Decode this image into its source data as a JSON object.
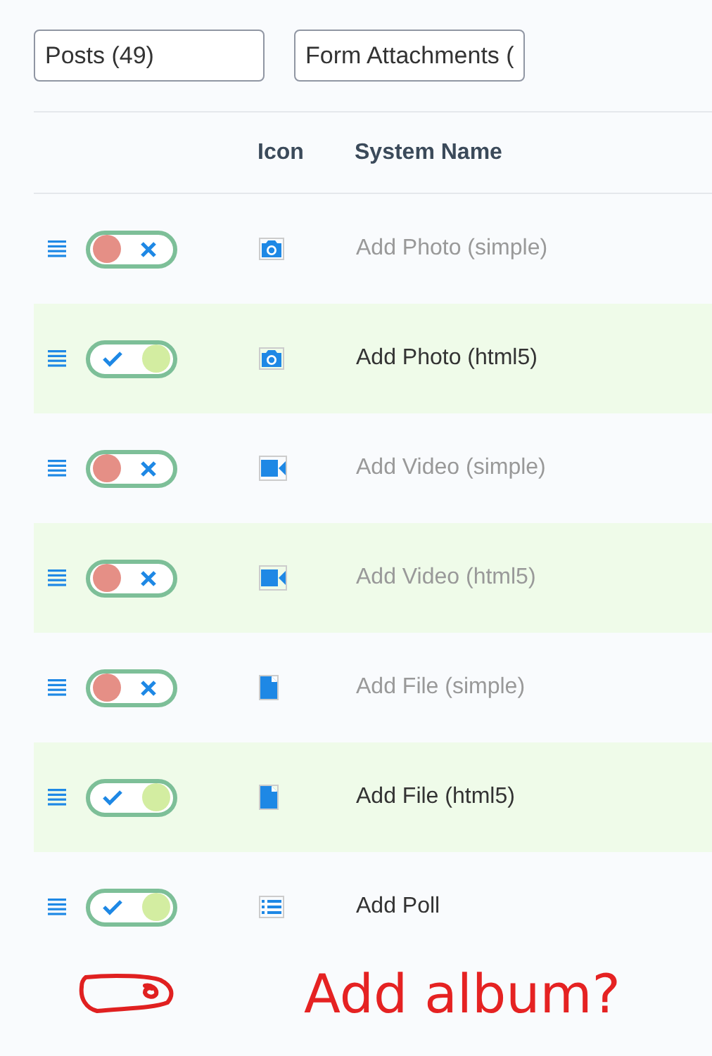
{
  "filters": [
    {
      "value": "Posts (49)"
    },
    {
      "value": "Form Attachments ("
    }
  ],
  "table": {
    "columns": [
      "Icon",
      "System Name"
    ],
    "rows": [
      {
        "on": false,
        "kind": "camera",
        "name": "Add Photo (simple)"
      },
      {
        "on": true,
        "kind": "camera",
        "name": "Add Photo (html5)"
      },
      {
        "on": false,
        "kind": "video",
        "name": "Add Video (simple)"
      },
      {
        "on": false,
        "kind": "video",
        "name": "Add Video (html5)"
      },
      {
        "on": false,
        "kind": "file",
        "name": "Add File (simple)"
      },
      {
        "on": true,
        "kind": "file",
        "name": "Add File (html5)"
      },
      {
        "on": true,
        "kind": "poll",
        "name": "Add Poll"
      }
    ]
  },
  "annotation": {
    "text": "Add album?"
  }
}
